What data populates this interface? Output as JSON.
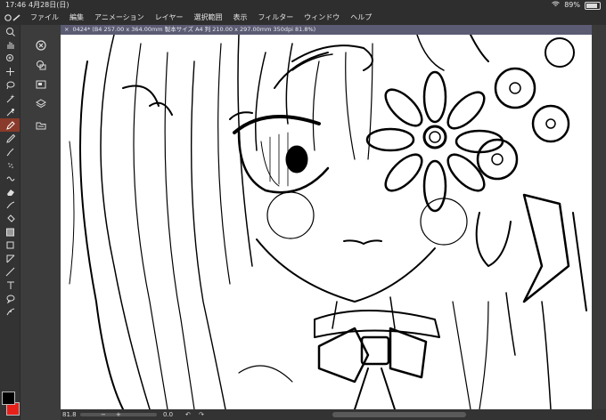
{
  "status": {
    "time": "17:46",
    "date": "4月28日(日)",
    "battery_percent": "89%",
    "battery_level": 0.89
  },
  "menu": {
    "items": [
      "ファイル",
      "編集",
      "アニメーション",
      "レイヤー",
      "選択範囲",
      "表示",
      "フィルター",
      "ウィンドウ",
      "ヘルプ"
    ]
  },
  "tools": [
    "search-icon",
    "hand-icon",
    "zoom-icon",
    "move-icon",
    "lasso-icon",
    "magic-wand-icon",
    "eyedropper-icon",
    "pen-icon",
    "pencil-icon",
    "brush-icon",
    "airbrush-icon",
    "decoration-icon",
    "eraser-icon",
    "blend-icon",
    "fill-icon",
    "gradient-icon",
    "shape-icon",
    "frame-icon",
    "ruler-icon",
    "text-icon",
    "balloon-icon",
    "line-fix-icon"
  ],
  "active_tool": "pen-icon",
  "colors": {
    "main": "#000000",
    "sub": "#e8201a",
    "accent": "#8a3a2a"
  },
  "document": {
    "tab_title": "0424* (B4 257.00 x 364.00mm 製本サイズ A4 判 210.00 x 297.00mm 350dpi 81.8%)"
  },
  "footer": {
    "zoom": "81.8",
    "minus": "−",
    "plus": "+",
    "zoom_value": "0.0",
    "undo": "↶",
    "redo": "↷"
  }
}
